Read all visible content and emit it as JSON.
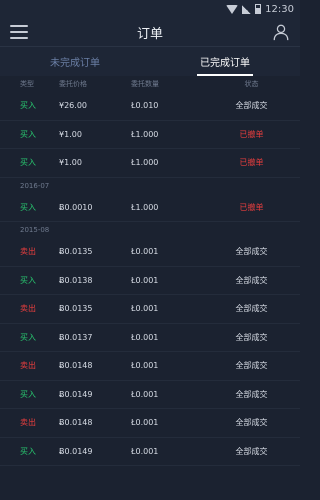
{
  "statusbar": {
    "time": "12:30"
  },
  "header": {
    "title": "订单"
  },
  "tabs": [
    {
      "label": "未完成订单",
      "active": false
    },
    {
      "label": "已完成订单",
      "active": true
    }
  ],
  "columns": {
    "type": "类型",
    "price": "委托价格",
    "qty": "委托数量",
    "status": "状态"
  },
  "groups": [
    {
      "label": "",
      "rows": [
        {
          "type": "买入",
          "side": "buy",
          "price": "¥26.00",
          "qty": "Ł0.010",
          "status": "全部成交",
          "status_type": "done"
        },
        {
          "type": "买入",
          "side": "buy",
          "price": "¥1.00",
          "qty": "Ł1.000",
          "status": "已撤单",
          "status_type": "cancel"
        },
        {
          "type": "买入",
          "side": "buy",
          "price": "¥1.00",
          "qty": "Ł1.000",
          "status": "已撤单",
          "status_type": "cancel"
        }
      ]
    },
    {
      "label": "2016-07",
      "rows": [
        {
          "type": "买入",
          "side": "buy",
          "price": "Ƀ0.0010",
          "qty": "Ł1.000",
          "status": "已撤单",
          "status_type": "cancel"
        }
      ]
    },
    {
      "label": "2015-08",
      "rows": [
        {
          "type": "卖出",
          "side": "sell",
          "price": "Ƀ0.0135",
          "qty": "Ł0.001",
          "status": "全部成交",
          "status_type": "done"
        },
        {
          "type": "买入",
          "side": "buy",
          "price": "Ƀ0.0138",
          "qty": "Ł0.001",
          "status": "全部成交",
          "status_type": "done"
        },
        {
          "type": "卖出",
          "side": "sell",
          "price": "Ƀ0.0135",
          "qty": "Ł0.001",
          "status": "全部成交",
          "status_type": "done"
        },
        {
          "type": "买入",
          "side": "buy",
          "price": "Ƀ0.0137",
          "qty": "Ł0.001",
          "status": "全部成交",
          "status_type": "done"
        },
        {
          "type": "卖出",
          "side": "sell",
          "price": "Ƀ0.0148",
          "qty": "Ł0.001",
          "status": "全部成交",
          "status_type": "done"
        },
        {
          "type": "买入",
          "side": "buy",
          "price": "Ƀ0.0149",
          "qty": "Ł0.001",
          "status": "全部成交",
          "status_type": "done"
        },
        {
          "type": "卖出",
          "side": "sell",
          "price": "Ƀ0.0148",
          "qty": "Ł0.001",
          "status": "全部成交",
          "status_type": "done"
        },
        {
          "type": "买入",
          "side": "buy",
          "price": "Ƀ0.0149",
          "qty": "Ł0.001",
          "status": "全部成交",
          "status_type": "done"
        }
      ]
    }
  ],
  "colors": {
    "buy": "#28c76f",
    "sell": "#ea3e3e",
    "background": "#1b2230",
    "tab_inactive": "#6b7fa6"
  }
}
